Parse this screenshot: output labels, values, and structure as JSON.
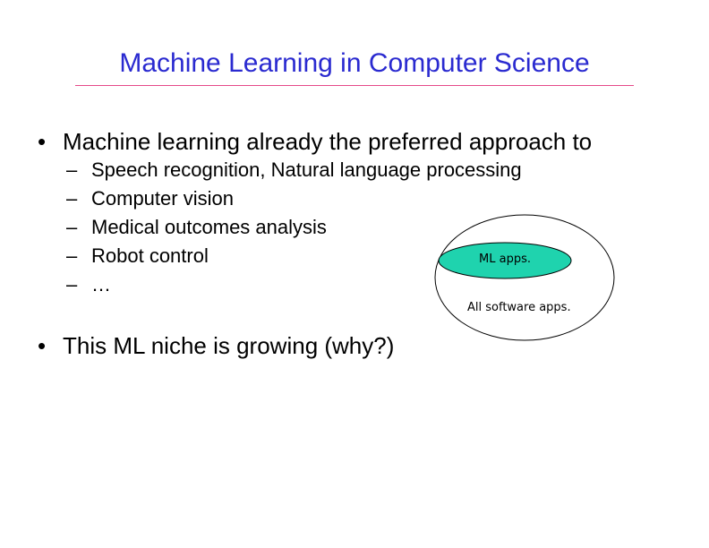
{
  "slide": {
    "title": "Machine Learning in Computer Science",
    "title_color": "#2a2ad0",
    "rule_color": "#e64a8a",
    "bullet_marker": "•",
    "dash_marker": "–",
    "bullets": [
      {
        "text": "Machine learning already the preferred approach to",
        "subitems": [
          "Speech recognition, Natural language processing",
          "Computer vision",
          "Medical outcomes analysis",
          "Robot control",
          "…"
        ]
      },
      {
        "text": "This ML niche is growing (why?)"
      }
    ],
    "diagram": {
      "inner_label": "ML apps.",
      "outer_label": "All software apps.",
      "inner_fill": "#1fd3ae"
    }
  }
}
